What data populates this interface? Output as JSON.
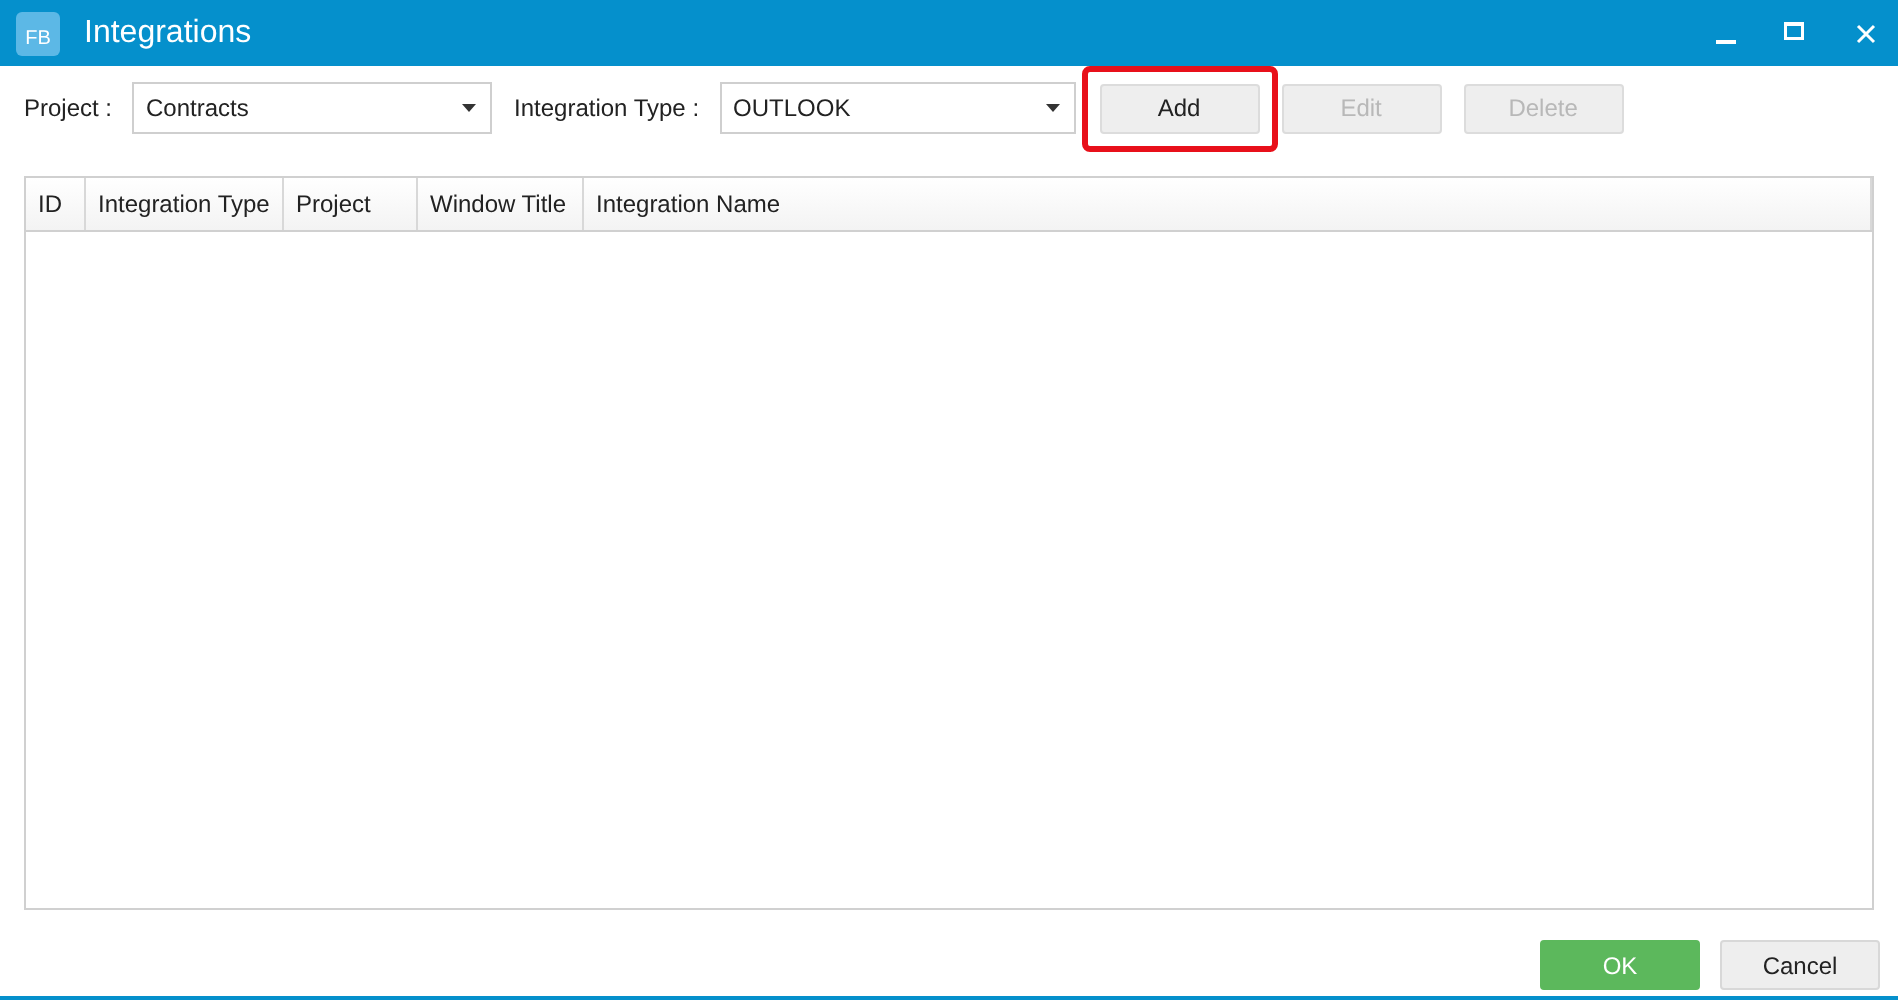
{
  "window": {
    "title": "Integrations",
    "logo": "FB"
  },
  "filters": [
    {
      "label": "Project :",
      "value": "Contracts"
    },
    {
      "label": "Integration Type :",
      "value": "OUTLOOK"
    }
  ],
  "actions": [
    {
      "label": "Add",
      "disabled": false,
      "highlighted": true
    },
    {
      "label": "Edit",
      "disabled": true,
      "highlighted": false
    },
    {
      "label": "Delete",
      "disabled": true,
      "highlighted": false
    }
  ],
  "table": {
    "columns": [
      "ID",
      "Integration Type",
      "Project",
      "Window Title",
      "Integration Name"
    ]
  },
  "footer": [
    {
      "label": "OK",
      "kind": "primary"
    },
    {
      "label": "Cancel",
      "kind": "secondary"
    }
  ]
}
